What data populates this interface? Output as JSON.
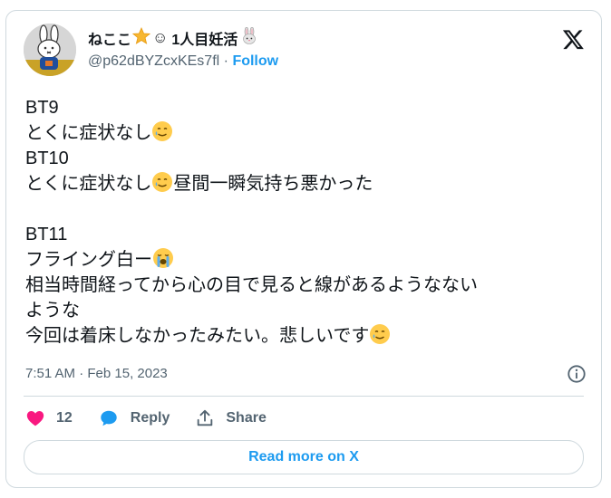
{
  "author": {
    "display_name": "ねここ",
    "name_suffix": "1人目妊活",
    "handle": "@p62dBYZcxKEs7fl",
    "separator": "·",
    "follow_label": "Follow"
  },
  "tweet": {
    "line1": "BT9",
    "line2": "とくに症状なし",
    "line3": "BT10",
    "line4a": "とくに症状なし",
    "line4b": "昼間一瞬気持ち悪かった",
    "line5": "BT11",
    "line6": "フライング白ー",
    "line7": "相当時間経ってから心の目で見ると線があるようなない",
    "line8": "ような",
    "line9": "今回は着床しなかったみたい。悲しいです"
  },
  "timestamp": "7:51 AM · Feb 15, 2023",
  "actions": {
    "like_count": "12",
    "reply_label": "Reply",
    "share_label": "Share"
  },
  "read_more_label": "Read more on X",
  "colors": {
    "accent": "#1d9bf0",
    "like": "#f91880",
    "muted": "#536471",
    "border": "#cfd9de"
  }
}
